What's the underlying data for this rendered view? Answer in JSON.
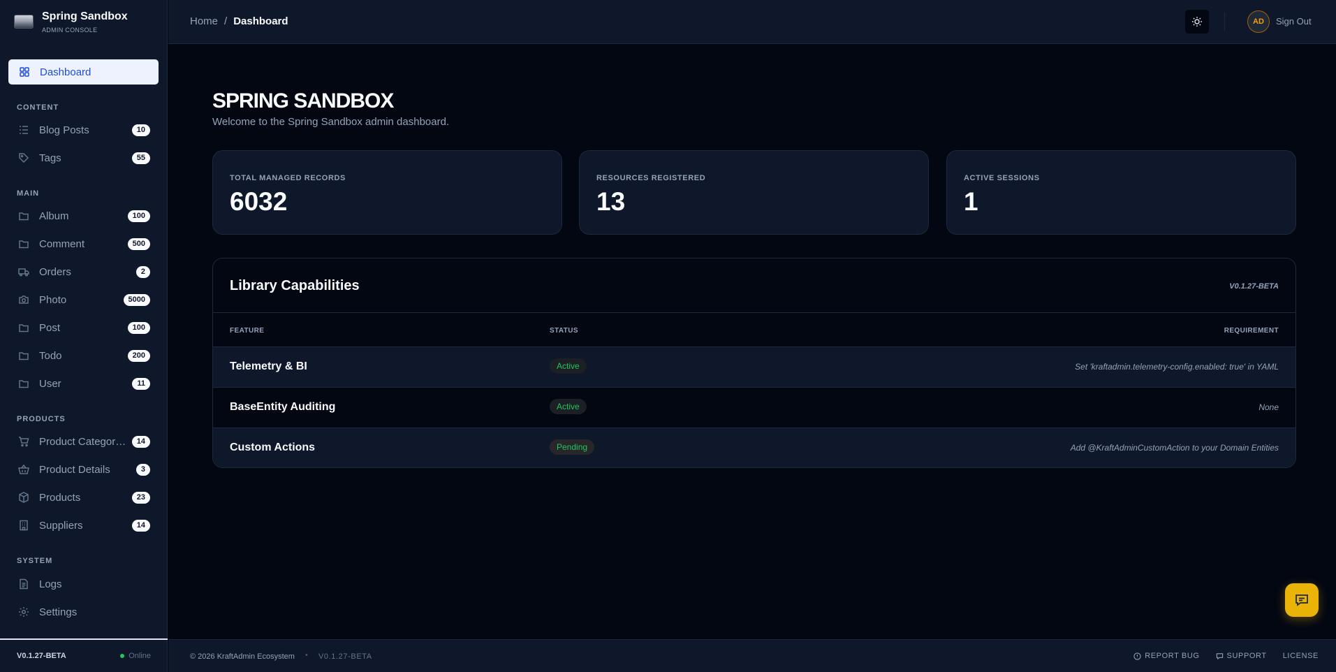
{
  "brand": {
    "title": "Spring Sandbox",
    "subtitle": "ADMIN CONSOLE"
  },
  "nav": {
    "active": {
      "label": "Dashboard",
      "icon": "grid-icon"
    },
    "sections": [
      {
        "title": "CONTENT",
        "items": [
          {
            "label": "Blog Posts",
            "count": "10",
            "icon": "list-icon"
          },
          {
            "label": "Tags",
            "count": "55",
            "icon": "tag-icon"
          }
        ]
      },
      {
        "title": "MAIN",
        "items": [
          {
            "label": "Album",
            "count": "100",
            "icon": "folder-icon"
          },
          {
            "label": "Comment",
            "count": "500",
            "icon": "folder-icon"
          },
          {
            "label": "Orders",
            "count": "2",
            "icon": "truck-icon"
          },
          {
            "label": "Photo",
            "count": "5000",
            "icon": "camera-icon"
          },
          {
            "label": "Post",
            "count": "100",
            "icon": "folder-icon"
          },
          {
            "label": "Todo",
            "count": "200",
            "icon": "folder-icon"
          },
          {
            "label": "User",
            "count": "11",
            "icon": "folder-icon"
          }
        ]
      },
      {
        "title": "PRODUCTS",
        "items": [
          {
            "label": "Product Categories",
            "count": "14",
            "icon": "cart-icon"
          },
          {
            "label": "Product Details",
            "count": "3",
            "icon": "basket-icon"
          },
          {
            "label": "Products",
            "count": "23",
            "icon": "box-icon"
          },
          {
            "label": "Suppliers",
            "count": "14",
            "icon": "building-icon"
          }
        ]
      },
      {
        "title": "SYSTEM",
        "items": [
          {
            "label": "Logs",
            "icon": "file-icon"
          },
          {
            "label": "Settings",
            "icon": "gear-icon"
          }
        ]
      }
    ]
  },
  "sidebar_footer": {
    "version": "V0.1.27-BETA",
    "status": "Online"
  },
  "header": {
    "breadcrumb_home": "Home",
    "breadcrumb_sep": "/",
    "breadcrumb_current": "Dashboard",
    "avatar_initials": "AD",
    "signout": "Sign Out"
  },
  "main": {
    "title": "SPRING SANDBOX",
    "subtitle": "Welcome to the Spring Sandbox admin dashboard.",
    "stats": [
      {
        "label": "TOTAL MANAGED RECORDS",
        "value": "6032"
      },
      {
        "label": "RESOURCES REGISTERED",
        "value": "13"
      },
      {
        "label": "ACTIVE SESSIONS",
        "value": "1"
      }
    ],
    "capabilities": {
      "title": "Library Capabilities",
      "version": "V0.1.27-BETA",
      "headers": {
        "feature": "FEATURE",
        "status": "STATUS",
        "requirement": "REQUIREMENT"
      },
      "rows": [
        {
          "feature": "Telemetry & BI",
          "status": "Active",
          "requirement": "Set 'kraftadmin.telemetry-config.enabled: true' in YAML"
        },
        {
          "feature": "BaseEntity Auditing",
          "status": "Active",
          "requirement": "None"
        },
        {
          "feature": "Custom Actions",
          "status": "Pending",
          "requirement": "Add @KraftAdminCustomAction to your Domain Entities"
        }
      ]
    }
  },
  "footer": {
    "copyright": "© 2026 KraftAdmin Ecosystem",
    "dot": "•",
    "version": "V0.1.27-BETA",
    "report_bug": "REPORT BUG",
    "support": "SUPPORT",
    "license": "LICENSE"
  },
  "colors": {
    "accent": "#1d4ed8",
    "fab": "#eab308",
    "status_ok": "#22c55e"
  }
}
